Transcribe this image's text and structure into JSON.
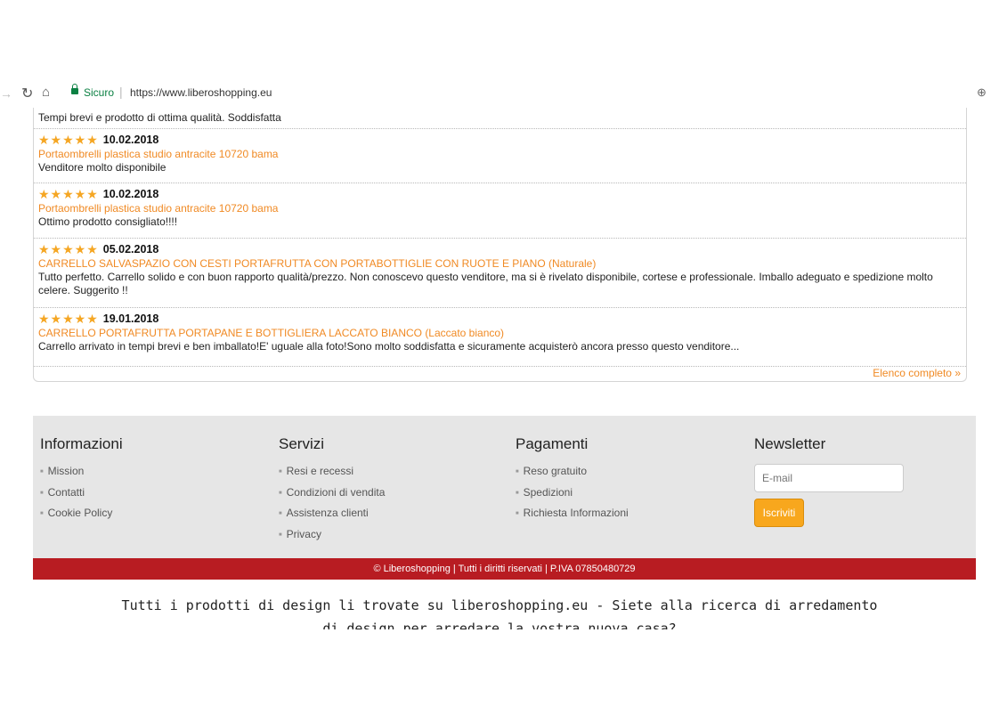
{
  "browser": {
    "secure_label": "Sicuro",
    "url": "https://www.liberoshopping.eu"
  },
  "reviews": {
    "first_comment": "Tempi brevi e prodotto di ottima qualità. Soddisfatta",
    "items": [
      {
        "stars": 5,
        "date": "10.02.2018",
        "product": "Portaombrelli plastica studio antracite 10720 bama",
        "comment": "Venditore molto disponibile"
      },
      {
        "stars": 5,
        "date": "10.02.2018",
        "product": "Portaombrelli plastica studio antracite 10720 bama",
        "comment": "Ottimo prodotto consigliato!!!!"
      },
      {
        "stars": 5,
        "date": "05.02.2018",
        "product": "CARRELLO SALVASPAZIO CON CESTI PORTAFRUTTA CON PORTABOTTIGLIE CON RUOTE E PIANO (Naturale)",
        "comment": "Tutto perfetto. Carrello solido e con buon rapporto qualità/prezzo. Non conoscevo questo venditore, ma si è rivelato disponibile, cortese e professionale. Imballo adeguato e spedizione molto celere. Suggerito !!"
      },
      {
        "stars": 5,
        "date": "19.01.2018",
        "product": "CARRELLO PORTAFRUTTA PORTAPANE E BOTTIGLIERA LACCATO BIANCO (Laccato bianco)",
        "comment": "Carrello arrivato in tempi brevi e ben imballato!E' uguale alla foto!Sono molto soddisfatta e sicuramente acquisterò ancora presso questo venditore..."
      }
    ],
    "full_list_link": "Elenco completo »"
  },
  "footer": {
    "informazioni": {
      "title": "Informazioni",
      "items": [
        "Mission",
        "Contatti",
        "Cookie Policy"
      ]
    },
    "servizi": {
      "title": "Servizi",
      "items": [
        "Resi e recessi",
        "Condizioni di vendita",
        "Assistenza clienti",
        "Privacy"
      ]
    },
    "pagamenti": {
      "title": "Pagamenti",
      "items": [
        "Reso gratuito",
        "Spedizioni",
        "Richiesta Informazioni"
      ]
    },
    "newsletter": {
      "title": "Newsletter",
      "email_placeholder": "E-mail",
      "subscribe_label": "Iscriviti"
    },
    "copyright": "© Liberoshopping | Tutti i diritti riservati | P.IVA 07850480729"
  },
  "seo_text": {
    "line1": "Tutti i prodotti di design li trovate su liberoshopping.eu - Siete alla ricerca di arredamento",
    "line2": "di design per arredare la vostra nuova casa?"
  },
  "colors": {
    "accent_orange": "#f08a24",
    "star_color": "#f5a623",
    "footer_bar_red": "#b81c22",
    "button_orange": "#f8a71d"
  }
}
